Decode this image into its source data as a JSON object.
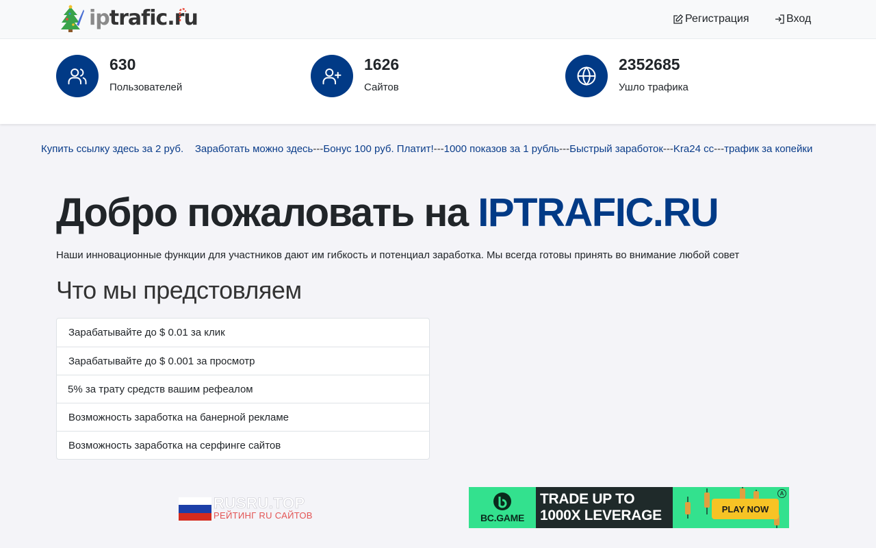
{
  "header": {
    "logo": {
      "prefix": "ip",
      "rest": "trafic.ru"
    },
    "nav": [
      {
        "label": "Регистрация",
        "icon": "edit-icon"
      },
      {
        "label": "Вход",
        "icon": "login-icon"
      }
    ]
  },
  "stats": [
    {
      "value": "630",
      "label": "Пользователей",
      "icon": "users-icon"
    },
    {
      "value": "1626",
      "label": "Сайтов",
      "icon": "user-plus-icon"
    },
    {
      "value": "2352685",
      "label": "Ушло трафика",
      "icon": "globe-icon"
    }
  ],
  "promo_links": {
    "first": "Купить ссылку здесь за 2 руб.",
    "items": [
      "Заработать можно здесь",
      "Бонус 100 руб. Платит!",
      "1000 показов за 1 рубль",
      "Быстрый заработок",
      "Kra24 cc",
      "трафик за копейки"
    ],
    "separator": "---"
  },
  "hero": {
    "title_prefix": "Добро пожаловать на",
    "title_brand": "IPTRAFIC.RU",
    "description": "Наши инновационные функции для участников дают им гибкость и потенциал заработка. Мы всегда готовы принять во внимание любой совет",
    "subtitle": "Что мы предстовляем"
  },
  "features": [
    "Зарабатывайте до $ 0.01 за клик",
    "Зарабатывайте до $ 0.001 за просмотр",
    "5% за трату средств вашим рефеалом",
    "Возможность заработка на банерной рекламе",
    "Возможность заработка на серфинге сайтов"
  ],
  "banners": {
    "rusru": {
      "title": "RUSRU.TOP",
      "subtitle": "РЕЙТИНГ RU САЙТОВ"
    },
    "bcgame": {
      "brand": "BC.GAME",
      "line1": "TRADE UP TO",
      "line2": "1000X LEVERAGE",
      "cta": "PLAY NOW"
    }
  },
  "colors": {
    "primary": "#013a86",
    "link": "#0b3d8a",
    "page_bg": "#f4f4f8",
    "bcgame_green": "#33e18e",
    "bcgame_yellow": "#f7c325"
  }
}
